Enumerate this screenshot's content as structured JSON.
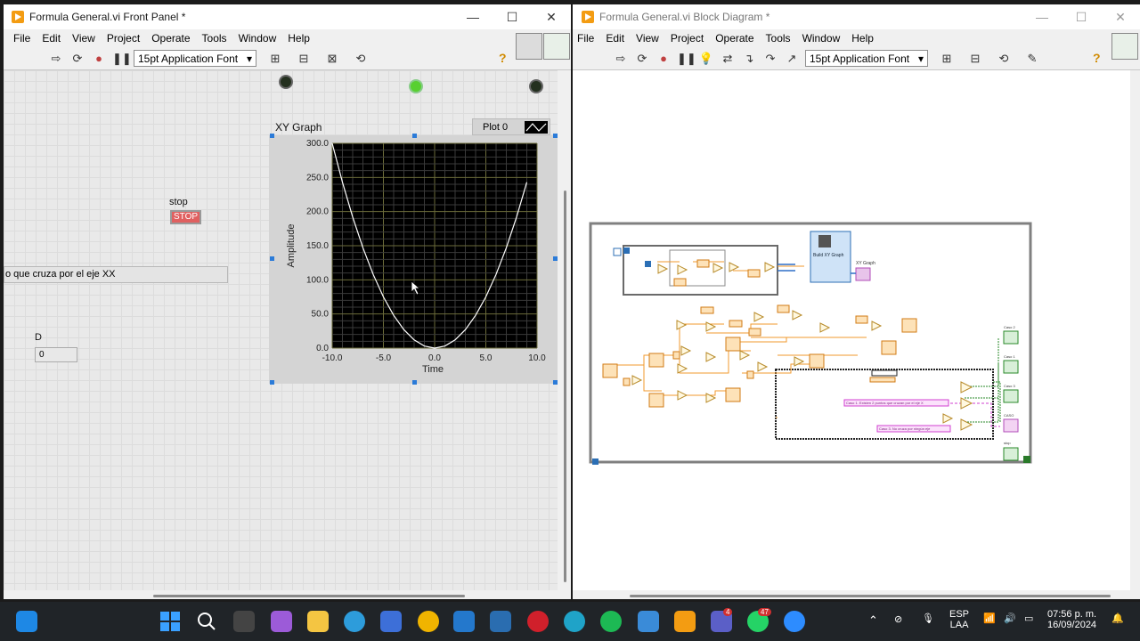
{
  "front_panel": {
    "title": "Formula General.vi Front Panel *",
    "menu": [
      "File",
      "Edit",
      "View",
      "Project",
      "Operate",
      "Tools",
      "Window",
      "Help"
    ],
    "font": "15pt Application Font",
    "stop_label": "stop",
    "stop_text": "STOP",
    "string_value": "o que cruza por  el eje XX",
    "d_label": "D",
    "d_value": "0",
    "graph_label": "XY Graph",
    "plot_legend": "Plot 0"
  },
  "block_diagram": {
    "title": "Formula General.vi Block Diagram *",
    "menu": [
      "File",
      "Edit",
      "View",
      "Project",
      "Operate",
      "Tools",
      "Window",
      "Help"
    ],
    "font": "15pt Application Font",
    "bundle_label": "Build XY Graph",
    "graph_terminal": "XY Graph",
    "case1_text": "Caso 1. Existen 2 puntos que cruzan por el eje X",
    "case3_text": "Caso 3. No cruza por ningún eje",
    "indicators": [
      "Caso 2",
      "Caso 1",
      "Caso 3",
      "CASO",
      "stop"
    ]
  },
  "chart_data": {
    "type": "line",
    "title": "",
    "xlabel": "Time",
    "ylabel": "Amplitude",
    "xlim": [
      -10,
      10
    ],
    "ylim": [
      0,
      300
    ],
    "x_ticks": [
      "-10.0",
      "-5.0",
      "0.0",
      "5.0",
      "10.0"
    ],
    "y_ticks": [
      "0.0",
      "50.0",
      "100.0",
      "150.0",
      "200.0",
      "250.0",
      "300.0"
    ],
    "series": [
      {
        "name": "Plot 0",
        "x": [
          -10,
          -9,
          -8,
          -7,
          -6,
          -5,
          -4,
          -3,
          -2,
          -1,
          0,
          1,
          2,
          3,
          4,
          5,
          6,
          7,
          8,
          9
        ],
        "y": [
          300,
          243,
          192,
          147,
          108,
          75,
          48,
          27,
          12,
          3,
          0,
          3,
          12,
          27,
          48,
          75,
          108,
          147,
          192,
          243
        ]
      }
    ],
    "grid": true,
    "background": "#000000",
    "line_color": "#ffffff"
  },
  "taskbar": {
    "lang": "ESP",
    "lang2": "LAA",
    "time": "07:56 p. m.",
    "date": "16/09/2024",
    "badge_teams": "4",
    "badge_whatsapp": "47"
  }
}
